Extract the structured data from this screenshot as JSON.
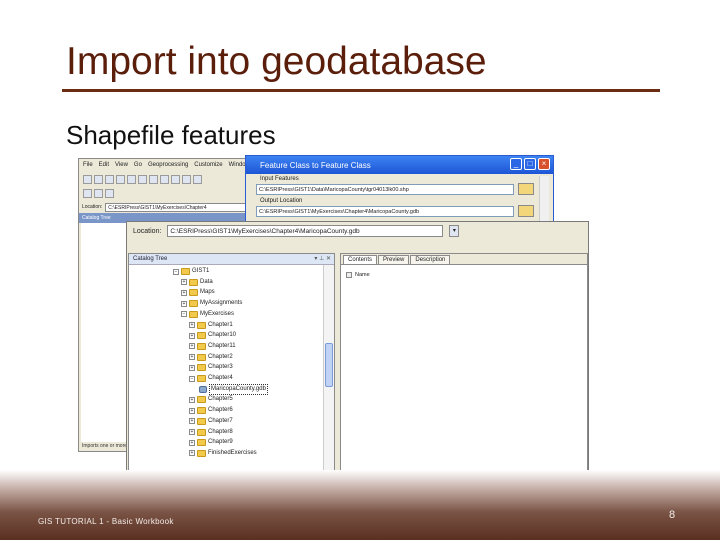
{
  "slide": {
    "title": "Import into geodatabase",
    "subtitle": "Shapefile features",
    "footer": "GIS TUTORIAL 1 - Basic Workbook",
    "page_number": "8"
  },
  "bg_window": {
    "menu": [
      "File",
      "Edit",
      "View",
      "Go",
      "Geoprocessing",
      "Customize",
      "Windo"
    ],
    "location_label": "Location:",
    "location_value": "C:\\ESRIPress\\GIST1\\MyExercises\\Chapter4",
    "catalog_tree_label": "Catalog Tree",
    "status": "Imports one or more"
  },
  "dialog": {
    "title": "Feature Class to Feature Class",
    "input_label": "Input Features",
    "input_value": "C:\\ESRIPress\\GIST1\\Data\\MaricopaCounty\\tgr04013lk00.shp",
    "output_label": "Output Location",
    "output_value": "C:\\ESRIPress\\GIST1\\MyExercises\\Chapter4\\MaricopaCounty.gdb"
  },
  "front_window": {
    "location_label": "Location:",
    "location_value": "C:\\ESRIPress\\GIST1\\MyExercises\\Chapter4\\MaricopaCounty.gdb",
    "catalog_tree_label": "Catalog Tree",
    "tabs": [
      "Contents",
      "Preview",
      "Description"
    ],
    "content_item": "Name",
    "tree": [
      {
        "label": "GIST1",
        "exp": "−",
        "type": "folder"
      },
      {
        "label": "Data",
        "exp": "+",
        "type": "folder"
      },
      {
        "label": "Maps",
        "exp": "+",
        "type": "folder"
      },
      {
        "label": "MyAssignments",
        "exp": "+",
        "type": "folder"
      },
      {
        "label": "MyExercises",
        "exp": "−",
        "type": "folder"
      },
      {
        "label": "Chapter1",
        "exp": "+",
        "type": "folder"
      },
      {
        "label": "Chapter10",
        "exp": "+",
        "type": "folder"
      },
      {
        "label": "Chapter11",
        "exp": "+",
        "type": "folder"
      },
      {
        "label": "Chapter2",
        "exp": "+",
        "type": "folder"
      },
      {
        "label": "Chapter3",
        "exp": "+",
        "type": "folder"
      },
      {
        "label": "Chapter4",
        "exp": "−",
        "type": "folder"
      },
      {
        "label": "MaricopaCounty.gdb",
        "exp": "",
        "type": "gdb"
      },
      {
        "label": "Chapter5",
        "exp": "+",
        "type": "folder"
      },
      {
        "label": "Chapter6",
        "exp": "+",
        "type": "folder"
      },
      {
        "label": "Chapter7",
        "exp": "+",
        "type": "folder"
      },
      {
        "label": "Chapter8",
        "exp": "+",
        "type": "folder"
      },
      {
        "label": "Chapter9",
        "exp": "+",
        "type": "folder"
      },
      {
        "label": "FinishedExercises",
        "exp": "+",
        "type": "folder"
      }
    ]
  }
}
